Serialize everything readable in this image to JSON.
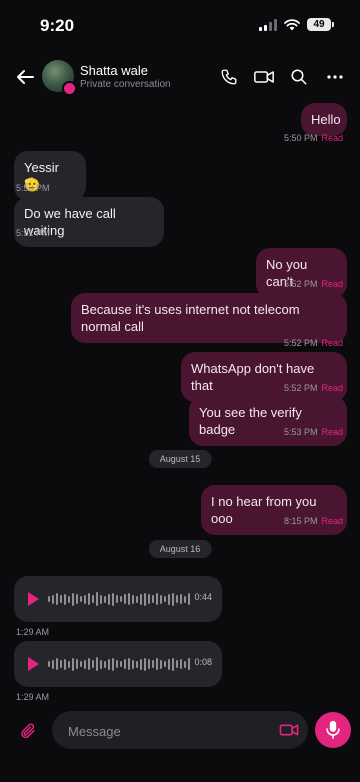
{
  "status_bar": {
    "time": "9:20",
    "battery": "49"
  },
  "header": {
    "contact_name": "Shatta wale",
    "subtitle": "Private conversation",
    "icons": [
      "back-arrow-icon",
      "phone-icon",
      "video-camera-icon",
      "search-icon",
      "more-icon"
    ]
  },
  "messages": [
    {
      "dir": "out",
      "text": "Hello",
      "time": "5:50 PM",
      "status": "Read"
    },
    {
      "dir": "in",
      "text": "Yessir 🫡",
      "time": "5:50 PM"
    },
    {
      "dir": "in",
      "text": "Do we have call waiting",
      "time": "5:51 PM"
    },
    {
      "dir": "out",
      "text": "No you can't",
      "time": "5:52 PM",
      "status": "Read"
    },
    {
      "dir": "out",
      "text": "Because it's uses internet not telecom normal call",
      "time": "5:52 PM",
      "status": "Read"
    },
    {
      "dir": "out",
      "text": "WhatsApp don't have that",
      "time": "5:52 PM",
      "status": "Read"
    },
    {
      "dir": "out",
      "text": "You see the verify badge",
      "time": "5:53 PM",
      "status": "Read"
    },
    {
      "dir": "date",
      "text": "August 15"
    },
    {
      "dir": "out",
      "text": "I no hear from you ooo",
      "time": "8:15 PM",
      "status": "Read"
    },
    {
      "dir": "date",
      "text": "August 16"
    },
    {
      "dir": "voice",
      "duration": "0:44",
      "time": "1:29 AM"
    },
    {
      "dir": "voice",
      "duration": "0:08",
      "time": "1:29 AM"
    }
  ],
  "composer": {
    "placeholder": "Message"
  },
  "colors": {
    "accent": "#e4257f",
    "outgoing_bubble": "#4a1530",
    "incoming_bubble": "#25252a",
    "background": "#0b0b0e"
  }
}
